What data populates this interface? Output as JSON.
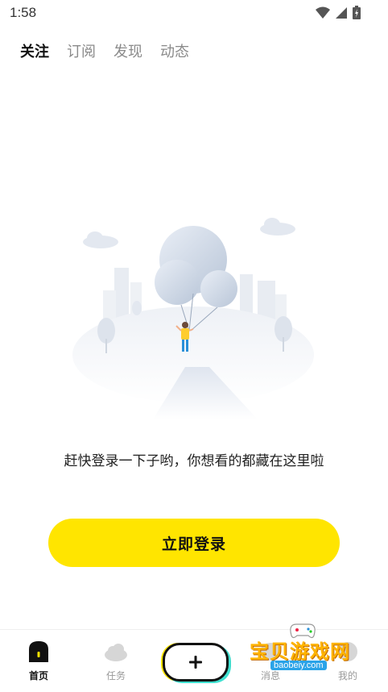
{
  "status_bar": {
    "time": "1:58"
  },
  "top_tabs": [
    {
      "label": "关注",
      "active": true
    },
    {
      "label": "订阅",
      "active": false
    },
    {
      "label": "发现",
      "active": false
    },
    {
      "label": "动态",
      "active": false
    }
  ],
  "empty_state": {
    "message": "赶快登录一下子哟，你想看的都藏在这里啦",
    "illustration_icon": "balloon-person-illustration"
  },
  "login_button": {
    "label": "立即登录"
  },
  "bottom_nav": {
    "items": [
      {
        "label": "首页",
        "icon": "home-icon",
        "active": true
      },
      {
        "label": "任务",
        "icon": "task-cloud-icon",
        "active": false
      },
      {
        "label": "消息",
        "icon": "message-icon",
        "active": false
      },
      {
        "label": "我的",
        "icon": "profile-icon",
        "active": false
      }
    ],
    "publish_icon": "plus-icon"
  },
  "watermark": {
    "text": "宝贝游戏网",
    "url": "baobeiy.com"
  },
  "colors": {
    "accent": "#ffe500",
    "teal": "#3fe0d0",
    "text": "#222222",
    "muted": "#999999"
  }
}
